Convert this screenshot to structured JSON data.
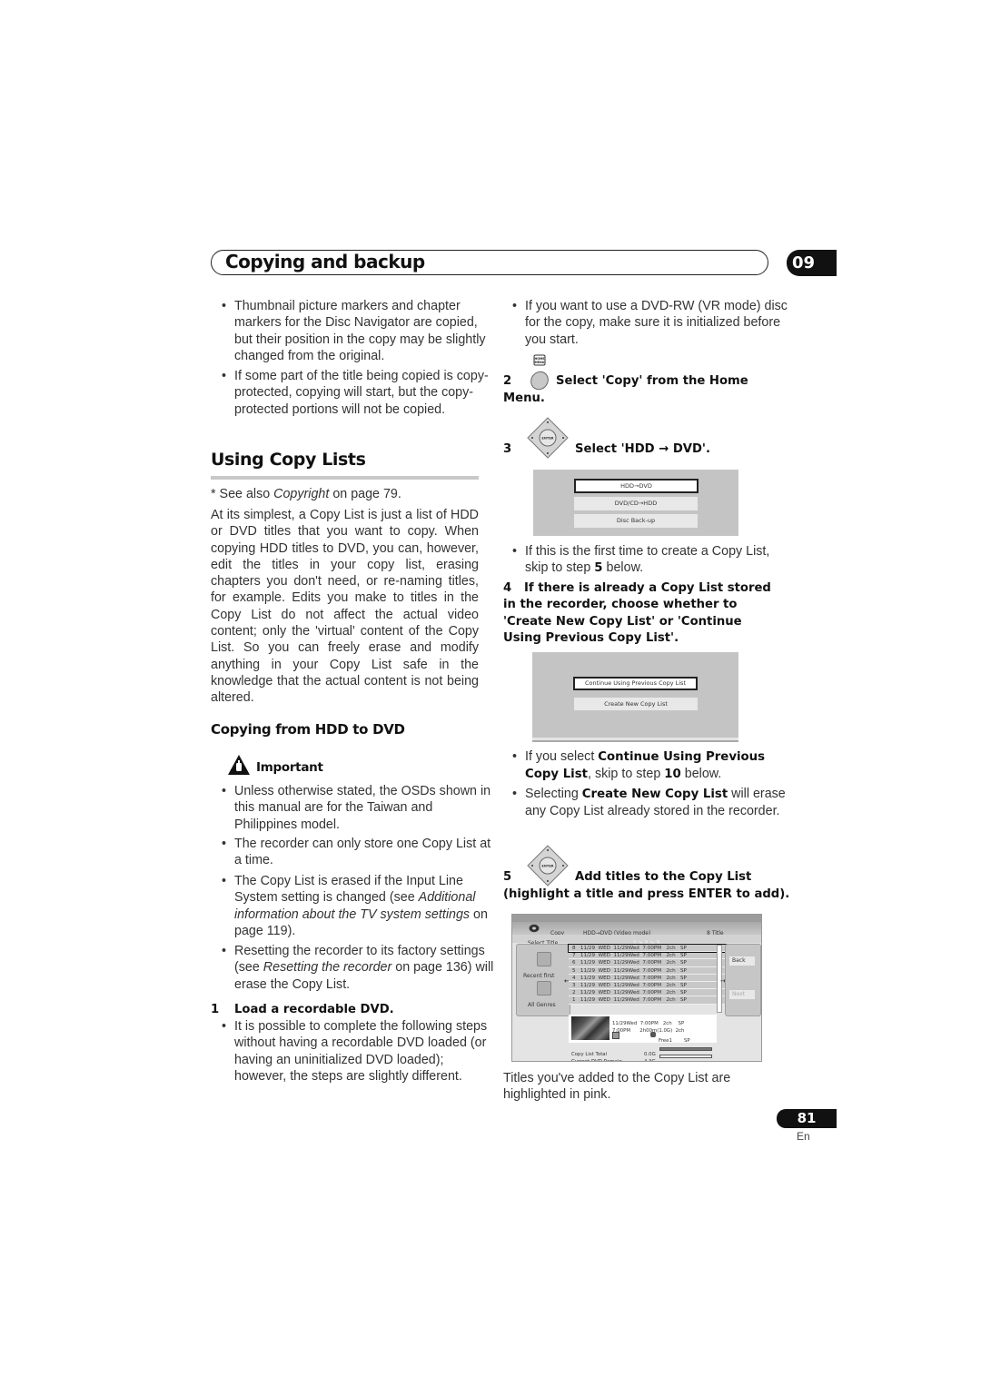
{
  "header": {
    "title": "Copying and backup",
    "chapter_number": "09"
  },
  "left_column": {
    "bullets_top": [
      "Thumbnail picture markers and chapter markers for the Disc Navigator are copied, but their position in the copy may be slightly changed from the original.",
      "If some part of the title being copied is copy-protected, copying will start, but the copy-protected portions will not be copied."
    ],
    "section_title": "Using Copy Lists",
    "see_also": {
      "prefix": "* See also ",
      "link": "Copyright",
      "suffix": " on page 79."
    },
    "intro_paragraph": "At its simplest, a Copy List is just a list of HDD or DVD titles that you want to copy. When copying HDD titles to DVD, you can, however, edit the titles in your copy list, erasing chapters you don't need, or re-naming titles, for example. Edits you make to titles in the Copy List do not affect the actual video content; only the 'virtual' content of the Copy List. So you can freely erase and modify anything in your Copy List safe in the knowledge that the actual content is not being altered.",
    "subsection_title": "Copying from HDD to DVD",
    "important_label": "Important",
    "important_bullets": [
      {
        "text": "Unless otherwise stated, the OSDs shown in this manual are for the Taiwan and Philippines model."
      },
      {
        "text": "The recorder can only store one Copy List at a time."
      },
      {
        "pre": "The Copy List is erased if the Input Line System setting is changed (see ",
        "ital": "Additional information about the TV system settings",
        "post": " on page 119)."
      },
      {
        "pre": "Resetting the recorder to its factory settings (see ",
        "ital": "Resetting the recorder",
        "post": " on page 136) will erase the Copy List."
      }
    ],
    "step1": {
      "number": "1",
      "title": "Load a recordable DVD.",
      "bullet": "It is possible to complete the following steps without having a recordable DVD loaded (or having an uninitialized DVD loaded); however, the steps are slightly different."
    }
  },
  "right_column": {
    "bullet_top": "If you want to use a DVD-RW (VR mode) disc for the copy, make sure it is initialized before you start.",
    "step2": {
      "number": "2",
      "button_icon": "home-menu-button-icon",
      "button_label": "HOME MENU",
      "title_line1": "Select 'Copy' from the Home",
      "title_line2": "Menu."
    },
    "step3": {
      "number": "3",
      "button_icon": "enter-dpad-icon",
      "title": "Select 'HDD → DVD'."
    },
    "osd_menu1": {
      "options": [
        {
          "label": "HDD→DVD",
          "selected": true
        },
        {
          "label": "DVD/CD→HDD",
          "selected": false
        },
        {
          "label": "Disc Back-up",
          "selected": false
        }
      ]
    },
    "first_time_bullet": {
      "pre": "If this is the first time to create a Copy List, skip to step ",
      "bold": "5",
      "post": " below."
    },
    "step4": {
      "number": "4",
      "title": "If there is already a Copy List stored in the recorder, choose whether to 'Create New Copy List' or 'Continue Using Previous Copy List'."
    },
    "osd_menu2": {
      "options": [
        {
          "label": "Continue Using Previous Copy List",
          "selected": true
        },
        {
          "label": "Create New Copy List",
          "selected": false
        }
      ]
    },
    "continue_bullet": {
      "pre": "If you select ",
      "bold1": "Continue Using Previous Copy List",
      "mid": ", skip to step ",
      "bold2": "10",
      "post": " below."
    },
    "create_bullet": {
      "pre": "Selecting ",
      "bold": "Create New Copy List",
      "post": " will erase any Copy List already stored in the recorder."
    },
    "step5": {
      "number": "5",
      "title_line1": "Add titles to the Copy List",
      "title_line2": "(highlight a title and press ENTER to add)."
    },
    "osd_copy": {
      "mode_label": "Copy",
      "mode_value": "HDD→DVD (Video mode)",
      "title_count": "8  Title",
      "select_title": "Select Title",
      "pages": "1 > 2 > 3",
      "sort_options": [
        "Recent first",
        "All Genres"
      ],
      "rows": [
        {
          "num": "8",
          "date": "11/29",
          "day": "WED",
          "rec": "11/29Wed",
          "time": "7:00PM",
          "ch": "2ch",
          "mode": "SP",
          "selected": true
        },
        {
          "num": "7",
          "date": "11/29",
          "day": "WED",
          "rec": "11/29Wed",
          "time": "7:00PM",
          "ch": "2ch",
          "mode": "SP",
          "selected": false
        },
        {
          "num": "6",
          "date": "11/29",
          "day": "WED",
          "rec": "11/29Wed",
          "time": "7:00PM",
          "ch": "2ch",
          "mode": "SP",
          "selected": false
        },
        {
          "num": "5",
          "date": "11/29",
          "day": "WED",
          "rec": "11/29Wed",
          "time": "7:00PM",
          "ch": "2ch",
          "mode": "SP",
          "selected": false
        },
        {
          "num": "4",
          "date": "11/29",
          "day": "WED",
          "rec": "11/29Wed",
          "time": "7:00PM",
          "ch": "2ch",
          "mode": "SP",
          "selected": false
        },
        {
          "num": "3",
          "date": "11/29",
          "day": "WED",
          "rec": "11/29Wed",
          "time": "7:00PM",
          "ch": "2ch",
          "mode": "SP",
          "selected": false
        },
        {
          "num": "2",
          "date": "11/29",
          "day": "WED",
          "rec": "11/29Wed",
          "time": "7:00PM",
          "ch": "2ch",
          "mode": "SP",
          "selected": false
        },
        {
          "num": "1",
          "date": "11/29",
          "day": "WED",
          "rec": "11/29Wed",
          "time": "7:00PM",
          "ch": "2ch",
          "mode": "SP",
          "selected": false
        }
      ],
      "buttons": {
        "back": "Back",
        "next": "Next"
      },
      "info": {
        "line1": "11/29Wed  7:00PM   2ch    SP",
        "line2": "7:00PM      2h00m(1.0G)  2ch",
        "genre": "Free1",
        "mode": "SP"
      },
      "copy_list_total_label": "Copy List Total",
      "copy_list_total_value": "0.0G",
      "copy_list_total_fill": 1.0,
      "dvd_remain_label": "Current DVD Remain",
      "dvd_remain_value": "4.3G",
      "dvd_remain_fill": 0.0
    },
    "caption": "Titles you've added to the Copy List are highlighted in pink."
  },
  "footer": {
    "page_number": "81",
    "language": "En"
  }
}
